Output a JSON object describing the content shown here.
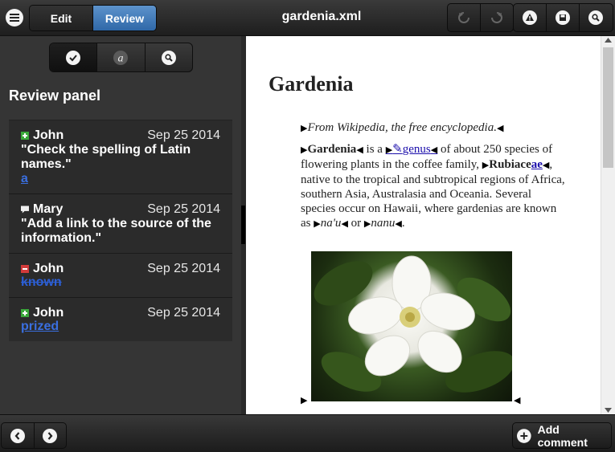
{
  "header": {
    "mode_tabs": [
      {
        "label": "Edit",
        "active": false
      },
      {
        "label": "Review",
        "active": true
      }
    ],
    "title": "gardenia.xml",
    "icons": [
      "menu-icon",
      "undo-icon",
      "redo-icon",
      "warning-icon",
      "save-icon",
      "search-icon"
    ]
  },
  "review_panel": {
    "title": "Review panel",
    "filters": [
      "checkmark-icon",
      "annotation-icon",
      "search-icon"
    ],
    "items": [
      {
        "type": "insertion",
        "author": "John",
        "date": "Sep 25 2014",
        "comment": "",
        "change": "a"
      },
      {
        "type": "comment",
        "author": "Mary",
        "date": "Sep 25 2014",
        "comment": "\"Add a link to the source of the information.\"",
        "change": ""
      },
      {
        "type": "deletion",
        "author": "John",
        "date": "Sep 25 2014",
        "comment": "",
        "change": "known"
      },
      {
        "type": "insertion",
        "author": "John",
        "date": "Sep 25 2014",
        "comment": "",
        "change": "prized"
      }
    ],
    "first_comment": "\"Check the spelling of Latin names.\""
  },
  "document": {
    "heading": "Gardenia",
    "source": "From Wikipedia, the free encyclopedia.",
    "p1_term": "Gardenia",
    "p1_a": "is a",
    "p1_link": "genus",
    "p1_b": "of about 250 species of flowering plants in the coffee family,",
    "p1_family": "Rubiace",
    "p1_family_insert": "ae",
    "p1_c": ", native to the tropical and subtropical regions of Africa, southern Asia, Australasia and Oceania. Several species occur on Hawaii, where gardenias are known as",
    "p1_name1": "na'u",
    "p1_or": "or",
    "p1_name2": "nanu",
    "p1_end": "."
  },
  "footer": {
    "add_comment_label": "Add comment"
  },
  "colors": {
    "accent_blue": "#3f7fc4",
    "insert_green": "#3aa83a",
    "delete_red": "#d23b3b",
    "change_link": "#3a6fe0"
  }
}
